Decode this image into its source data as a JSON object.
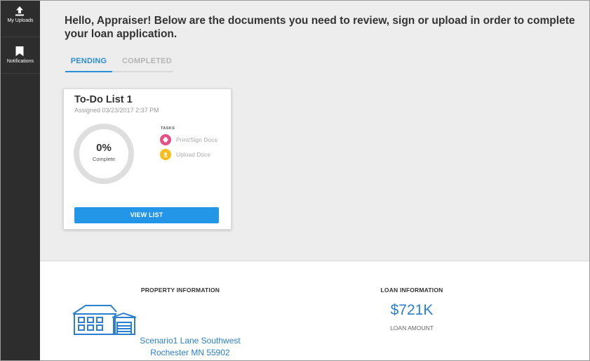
{
  "sidebar": {
    "items": [
      {
        "label": "My Uploads",
        "icon": "upload-icon"
      },
      {
        "label": "Notifications",
        "icon": "bookmark-icon"
      }
    ]
  },
  "header": {
    "greeting": "Hello, Appraiser! Below are the documents you need to review, sign or upload in order to complete your loan application."
  },
  "tabs": [
    {
      "label": "PENDING",
      "active": true
    },
    {
      "label": "COMPLETED",
      "active": false
    }
  ],
  "todo_card": {
    "title": "To-Do List 1",
    "assigned": "Assigned 03/23/2017 2:37 PM",
    "progress_value": "0%",
    "progress_label": "Complete",
    "progress_fraction": 0,
    "tasks_heading": "TASKS",
    "tasks": [
      {
        "label": "Print/Sign Docs",
        "icon": "printer-icon",
        "color": "#e64f86"
      },
      {
        "label": "Upload Docs",
        "icon": "upload-icon",
        "color": "#f6bd1b"
      }
    ],
    "button_label": "VIEW LIST"
  },
  "property": {
    "heading": "PROPERTY INFORMATION",
    "icon": "house-icon",
    "address_line1": "Scenario1 Lane Southwest",
    "address_line2": "Rochester MN 55902"
  },
  "loan": {
    "heading": "LOAN INFORMATION",
    "amount": "$721K",
    "amount_label": "LOAN AMOUNT"
  },
  "colors": {
    "accent": "#2396e7",
    "sidebar_bg": "#2d2d2d",
    "link_blue": "#2b7fd0"
  }
}
